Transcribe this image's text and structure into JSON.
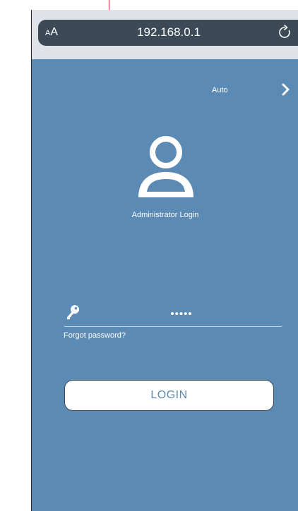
{
  "browser": {
    "text_size_small": "A",
    "text_size_large": "A",
    "url": "192.168.0.1"
  },
  "page": {
    "language": "Auto",
    "admin_label": "Administrator Login",
    "password_value": "•••••",
    "forgot_password": "Forgot password?",
    "login_label": "LOGIN"
  },
  "colors": {
    "background_blue": "#5b8ab4",
    "address_bar": "#3b4a56",
    "button_text": "#5b8ab4"
  }
}
